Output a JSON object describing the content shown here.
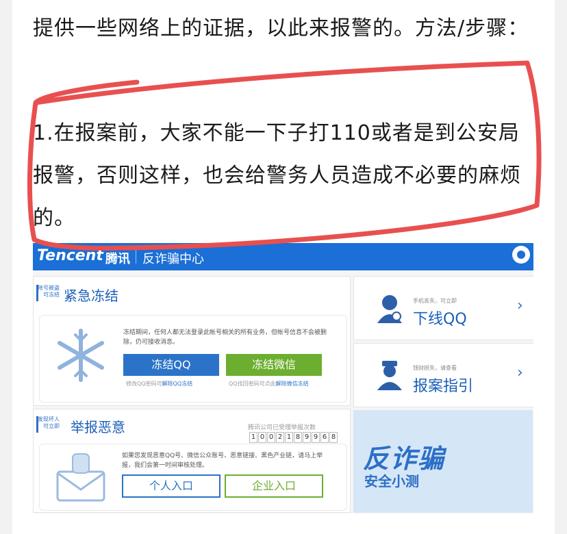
{
  "article": {
    "intro": "提供一些网络上的证据，以此来报警的。方法/步骤：",
    "step1": "1.在报案前，大家不能一下子打110或者是到公安局报警，否则这样，也会给警务人员造成不必要的麻烦的。"
  },
  "screenshot": {
    "brand": "Tencent",
    "brand_cn": "腾讯",
    "center_title": "反诈骗中心",
    "freeze": {
      "tag": "帐号被盗可冻结",
      "title": "紧急冻结",
      "desc": "冻结期间，任何人都无法登录此帐号相关的所有业务，但帐号信息不会被删除，仍可接收消息。",
      "btn_qq": "冻结QQ",
      "btn_wx": "冻结微信",
      "hint_qq_prefix": "修改QQ密码可",
      "hint_qq_link": "解除QQ冻结",
      "hint_wx_prefix": "QQ找回密码可点此",
      "hint_wx_link": "解除微信冻结"
    },
    "report": {
      "tag": "发现坏人可立即",
      "title": "举报恶意",
      "counter_label": "腾讯公司已受理举报次数",
      "digits": [
        "1",
        "0",
        "0",
        "2",
        "1",
        "8",
        "9",
        "9",
        "6",
        "8"
      ],
      "desc": "如果您发现恶意QQ号、微信公众账号、恶意链接、黑色产业链，请马上举报，我们会第一时间审核处理。",
      "btn_personal": "个人入口",
      "btn_company": "企业入口"
    },
    "offline": {
      "small": "手机丢失，可立即",
      "big": "下线QQ"
    },
    "guide": {
      "small": "钱财损失，请查看",
      "big": "报案指引"
    },
    "banner": {
      "line1": "反诈骗",
      "line2": "安全小测"
    },
    "colors": {
      "brand_blue": "#1b6fd6",
      "wechat_green": "#6cae2f",
      "annotation_red": "#e8504f"
    }
  }
}
